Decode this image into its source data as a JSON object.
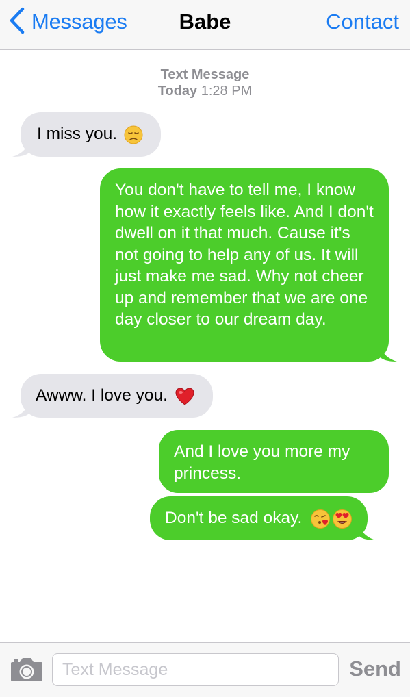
{
  "colors": {
    "accent": "#1b7cf2",
    "incoming_bubble": "#e5e5ea",
    "outgoing_bubble": "#4ccd2b",
    "meta_text": "#8e8e93"
  },
  "navbar": {
    "back_label": "Messages",
    "back_icon": "chevron-left-icon",
    "title": "Babe",
    "right_label": "Contact"
  },
  "thread_header": {
    "type": "Text Message",
    "day": "Today",
    "time": "1:28 PM"
  },
  "messages": [
    {
      "direction": "incoming",
      "text": "I miss you.",
      "emoji": [
        "disappointed-face-emoji"
      ]
    },
    {
      "direction": "outgoing",
      "text": "You don't have to tell me, I know how it exactly feels like. And I don't dwell on it that much. Cause it's not going to help any of us. It will just make me sad. Why not cheer up and remember that we are one day closer to our dream day."
    },
    {
      "direction": "incoming",
      "text": "Awww. I love you.",
      "emoji": [
        "red-heart-emoji"
      ]
    },
    {
      "direction": "outgoing",
      "text": "And I love you more my princess."
    },
    {
      "direction": "outgoing",
      "text": "Don't be sad okay.",
      "emoji": [
        "face-blowing-kiss-emoji",
        "heart-eyes-emoji"
      ]
    }
  ],
  "input_bar": {
    "camera_icon": "camera-icon",
    "placeholder": "Text Message",
    "value": "",
    "send_label": "Send"
  }
}
